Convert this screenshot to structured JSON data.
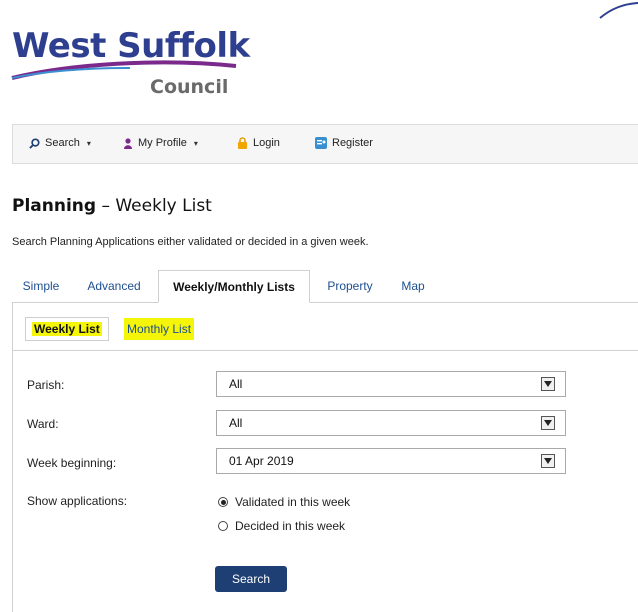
{
  "logo": {
    "line1": "West Suffolk",
    "line2": "Council"
  },
  "nav": {
    "search": "Search",
    "my_profile": "My Profile",
    "login": "Login",
    "register": "Register"
  },
  "page": {
    "title_bold": "Planning",
    "title_rest": " – Weekly List",
    "description": "Search Planning Applications either validated or decided in a given week."
  },
  "tabs": [
    "Simple",
    "Advanced",
    "Weekly/Monthly Lists",
    "Property",
    "Map"
  ],
  "subtabs": [
    "Weekly List",
    "Monthly List"
  ],
  "form": {
    "parish_label": "Parish:",
    "parish_value": "All",
    "ward_label": "Ward:",
    "ward_value": "All",
    "week_label": "Week beginning:",
    "week_value": "01 Apr 2019",
    "show_label": "Show applications:",
    "option_validated": "Validated in this week",
    "option_decided": "Decided in this week",
    "selected_option": "validated",
    "search_button": "Search"
  },
  "colors": {
    "brand_blue": "#2e3f8f",
    "brand_purple": "#7b2a8c",
    "link_blue": "#1d4f91",
    "highlight_yellow": "#f5f50a",
    "button_navy": "#1d3f73"
  }
}
